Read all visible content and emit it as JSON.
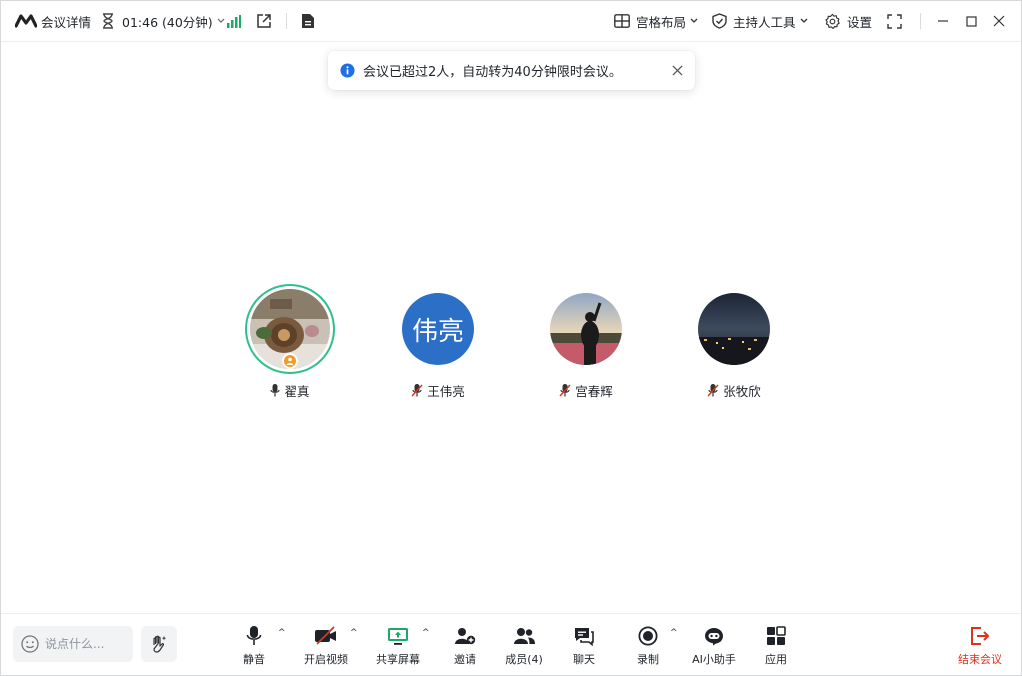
{
  "topbar": {
    "meeting_info": "会议详情",
    "timer": "01:46 (40分钟)",
    "layout": "宫格布局",
    "host_tools": "主持人工具",
    "settings": "设置"
  },
  "toast": {
    "message": "会议已超过2人，自动转为40分钟限时会议。"
  },
  "participants": [
    {
      "name": "翟真",
      "mic": "on",
      "host": true
    },
    {
      "name": "王伟亮",
      "initials": "伟亮",
      "mic": "muted"
    },
    {
      "name": "宫春辉",
      "mic": "muted"
    },
    {
      "name": "张牧欣",
      "mic": "muted"
    }
  ],
  "bottombar": {
    "chat_placeholder": "说点什么...",
    "mute": "静音",
    "video": "开启视频",
    "share": "共享屏幕",
    "invite": "邀请",
    "members": "成员(4)",
    "chat": "聊天",
    "record": "录制",
    "ai": "AI小助手",
    "apps": "应用",
    "end": "结束会议"
  },
  "colors": {
    "accent_green": "#2fc08a",
    "share_green": "#1aaa6a",
    "end_red": "#e0301e",
    "info_blue": "#1f6fe5",
    "avatar_blue": "#2b6fc6",
    "host_orange": "#f19c2a"
  }
}
